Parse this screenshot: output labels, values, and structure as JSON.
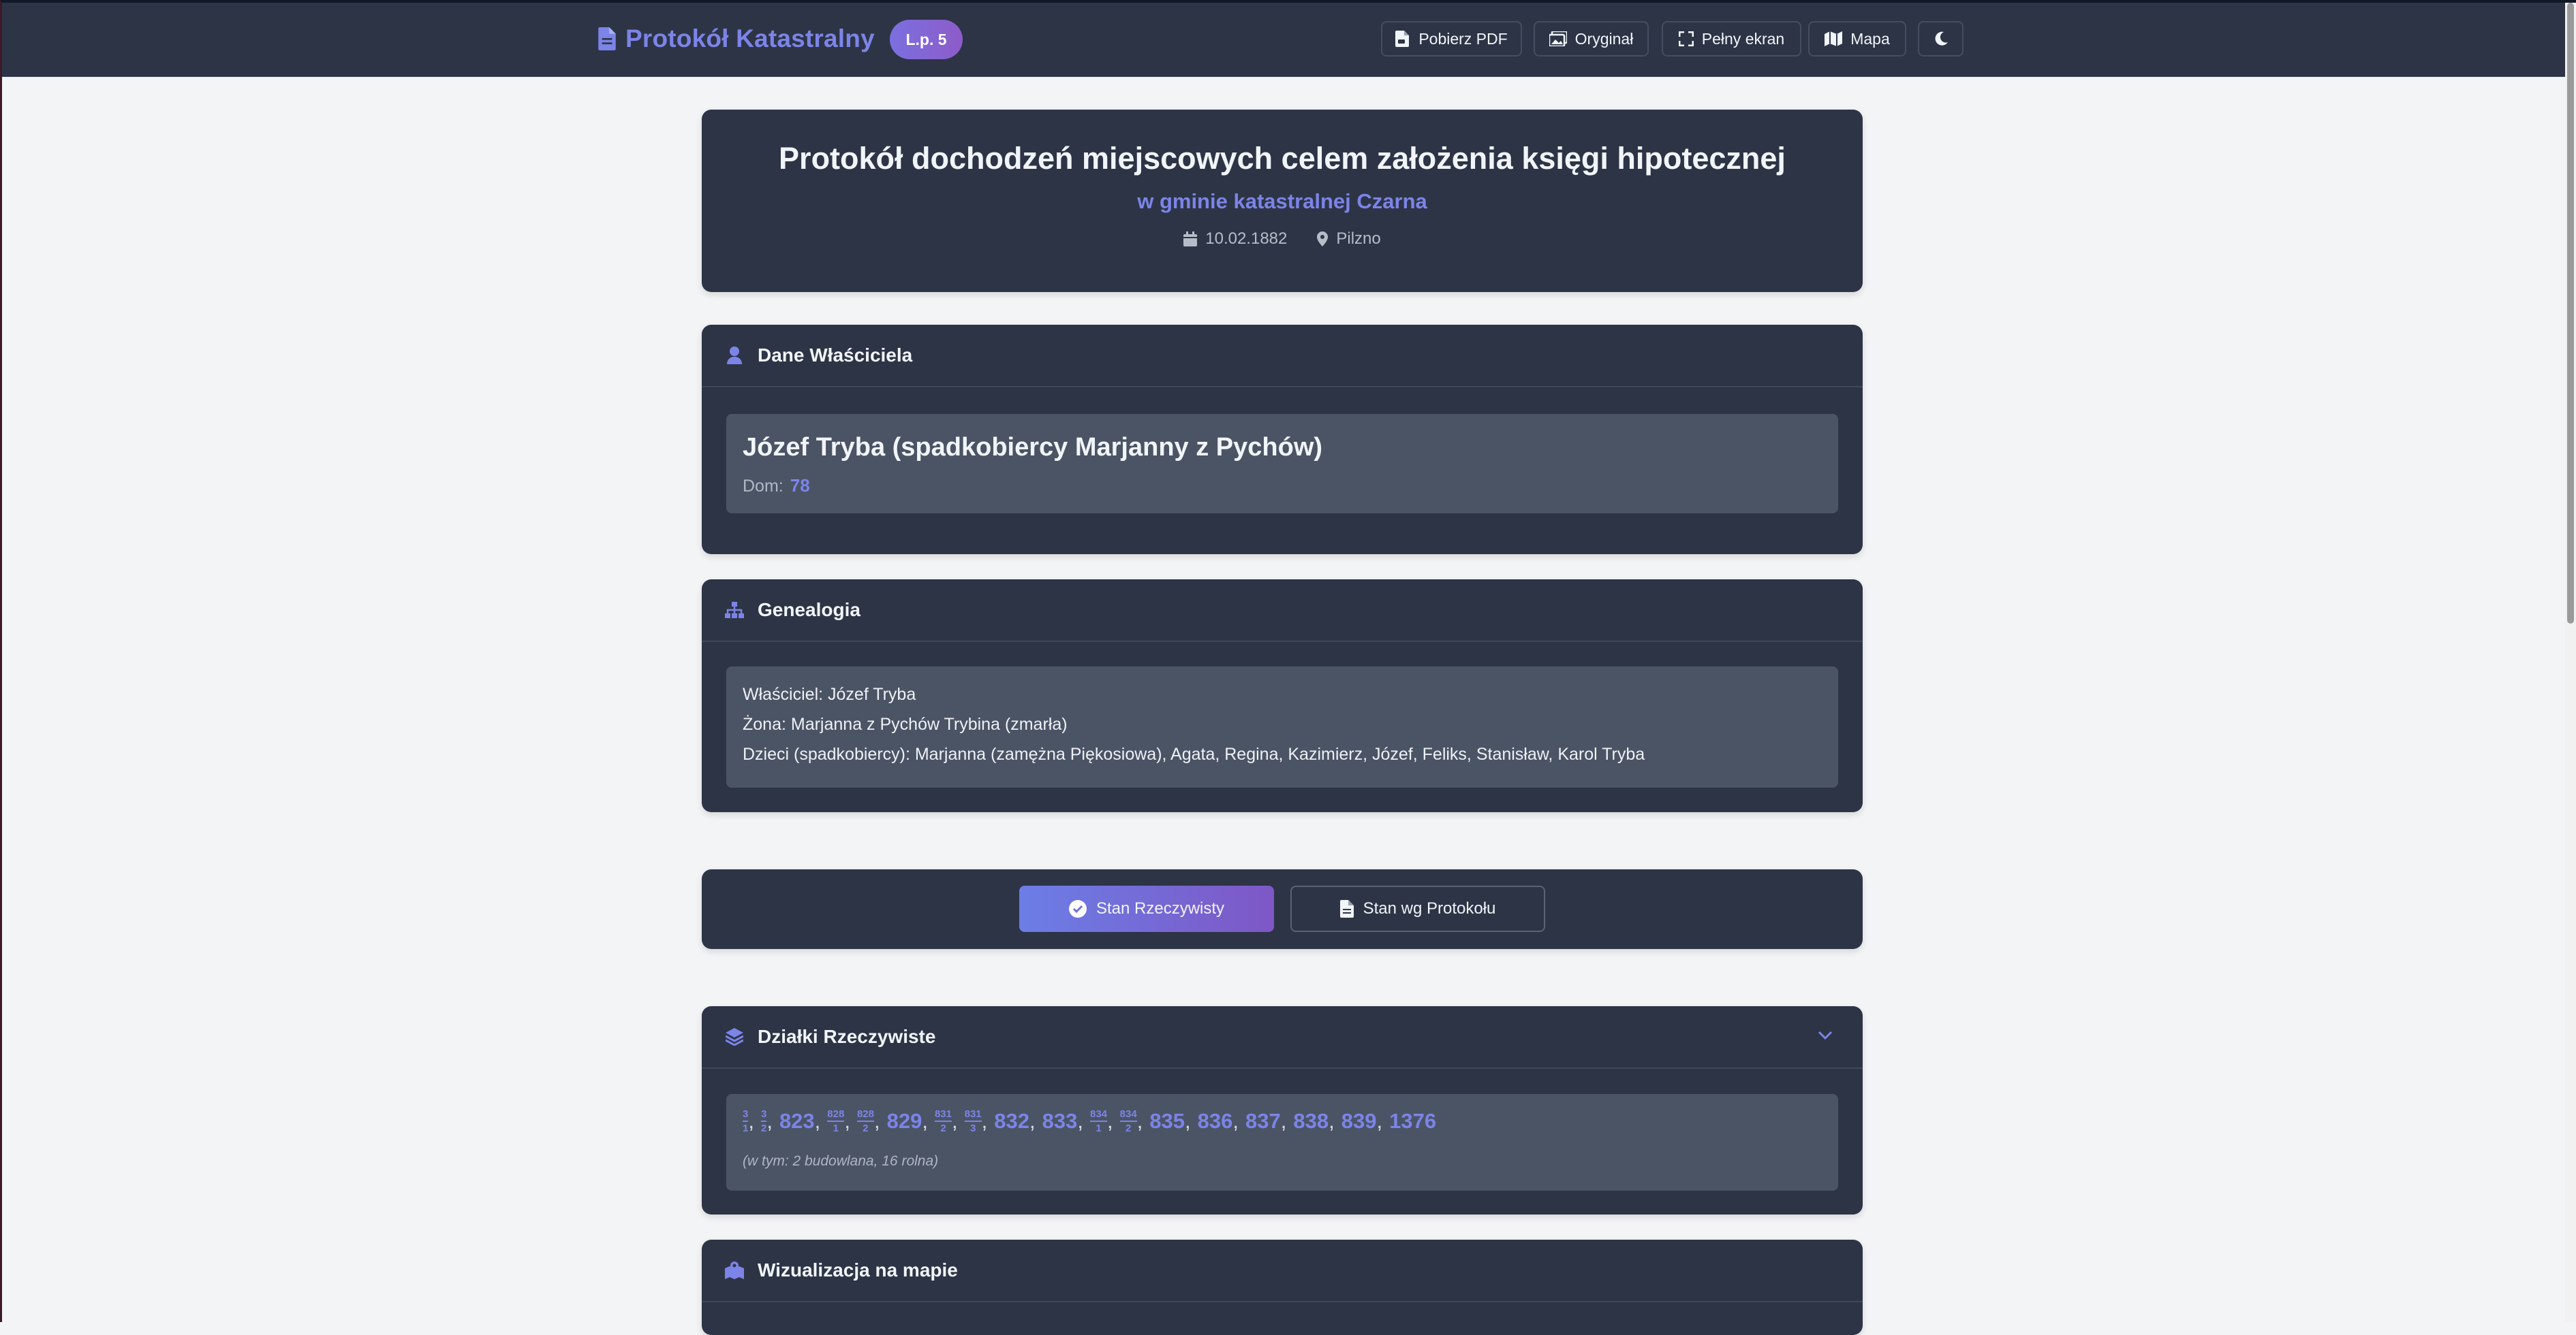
{
  "brand": {
    "title": "Protokół Katastralny",
    "badge": "L.p. 5"
  },
  "nav": {
    "pdf": "Pobierz PDF",
    "original": "Oryginał",
    "fullscreen": "Pełny ekran",
    "map": "Mapa"
  },
  "hero": {
    "title": "Protokół dochodzeń miejscowych celem założenia księgi hipotecznej",
    "subtitle": "w gminie katastralnej Czarna",
    "date": "10.02.1882",
    "place": "Pilzno"
  },
  "owner": {
    "section_title": "Dane Właściciela",
    "name": "Józef Tryba (spadkobiercy Marjanny z Pychów)",
    "dom_label": "Dom:",
    "dom_number": "78"
  },
  "genealogy": {
    "section_title": "Genealogia",
    "lines": [
      "Właściciel: Józef Tryba",
      "Żona: Marjanna z Pychów Trybina (zmarła)",
      "Dzieci (spadkobiercy): Marjanna (zamężna Piękosiowa), Agata, Regina, Kazimierz, Józef, Feliks, Stanisław, Karol Tryba"
    ]
  },
  "toggle": {
    "active": "Stan Rzeczywisty",
    "inactive": "Stan wg Protokołu"
  },
  "parcels_section": {
    "title": "Działki Rzeczywiste",
    "parcels": [
      {
        "num": "3",
        "den": "1"
      },
      {
        "num": "3",
        "den": "2"
      },
      {
        "text": "823"
      },
      {
        "num": "828",
        "den": "1"
      },
      {
        "num": "828",
        "den": "2"
      },
      {
        "text": "829"
      },
      {
        "num": "831",
        "den": "2"
      },
      {
        "num": "831",
        "den": "3"
      },
      {
        "text": "832"
      },
      {
        "text": "833"
      },
      {
        "num": "834",
        "den": "1"
      },
      {
        "num": "834",
        "den": "2"
      },
      {
        "text": "835"
      },
      {
        "text": "836"
      },
      {
        "text": "837"
      },
      {
        "text": "838"
      },
      {
        "text": "839"
      },
      {
        "text": "1376"
      }
    ],
    "note": "(w tym: 2 budowlana, 16 rolna)"
  },
  "map_section": {
    "title": "Wizualizacja na mapie"
  },
  "colors": {
    "accent": "#7c84e8",
    "card": "#2d3446",
    "inner": "#4b5465",
    "page": "#f3f4f6"
  }
}
